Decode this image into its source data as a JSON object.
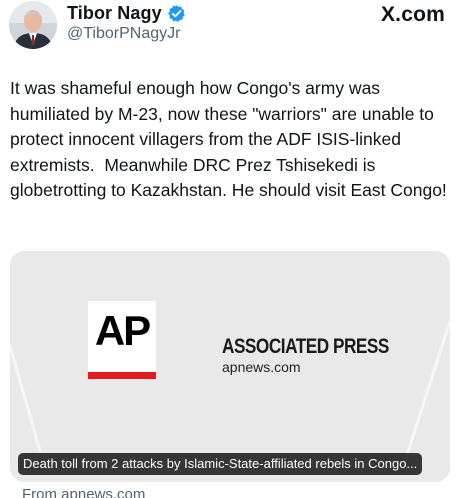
{
  "author": {
    "name": "Tibor Nagy",
    "handle": "@TiborPNagyJr",
    "verified": true,
    "avatar": "person-headshot"
  },
  "brand": {
    "label": "X.com"
  },
  "tweet": {
    "text": "It was shameful enough how Congo's army was humiliated by M-23, now these \"warriors\" are unable to protect innocent villagers from the ADF ISIS-linked extremists.  Meanwhile DRC Prez Tshisekedi is globetrotting to Kazakhstan. He should visit East Congo!"
  },
  "card": {
    "logo_text": "AP",
    "publisher": "ASSOCIATED PRESS",
    "domain": "apnews.com",
    "caption": "Death toll from 2 attacks by Islamic-State-affiliated rebels in Congo...",
    "background_color": "#e9e9e9",
    "logo_accent": "#e41a1c"
  },
  "source": {
    "text": "From apnews.com"
  },
  "colors": {
    "text": "#0f1419",
    "secondary_text": "#536471",
    "verified": "#1d9bf0"
  }
}
